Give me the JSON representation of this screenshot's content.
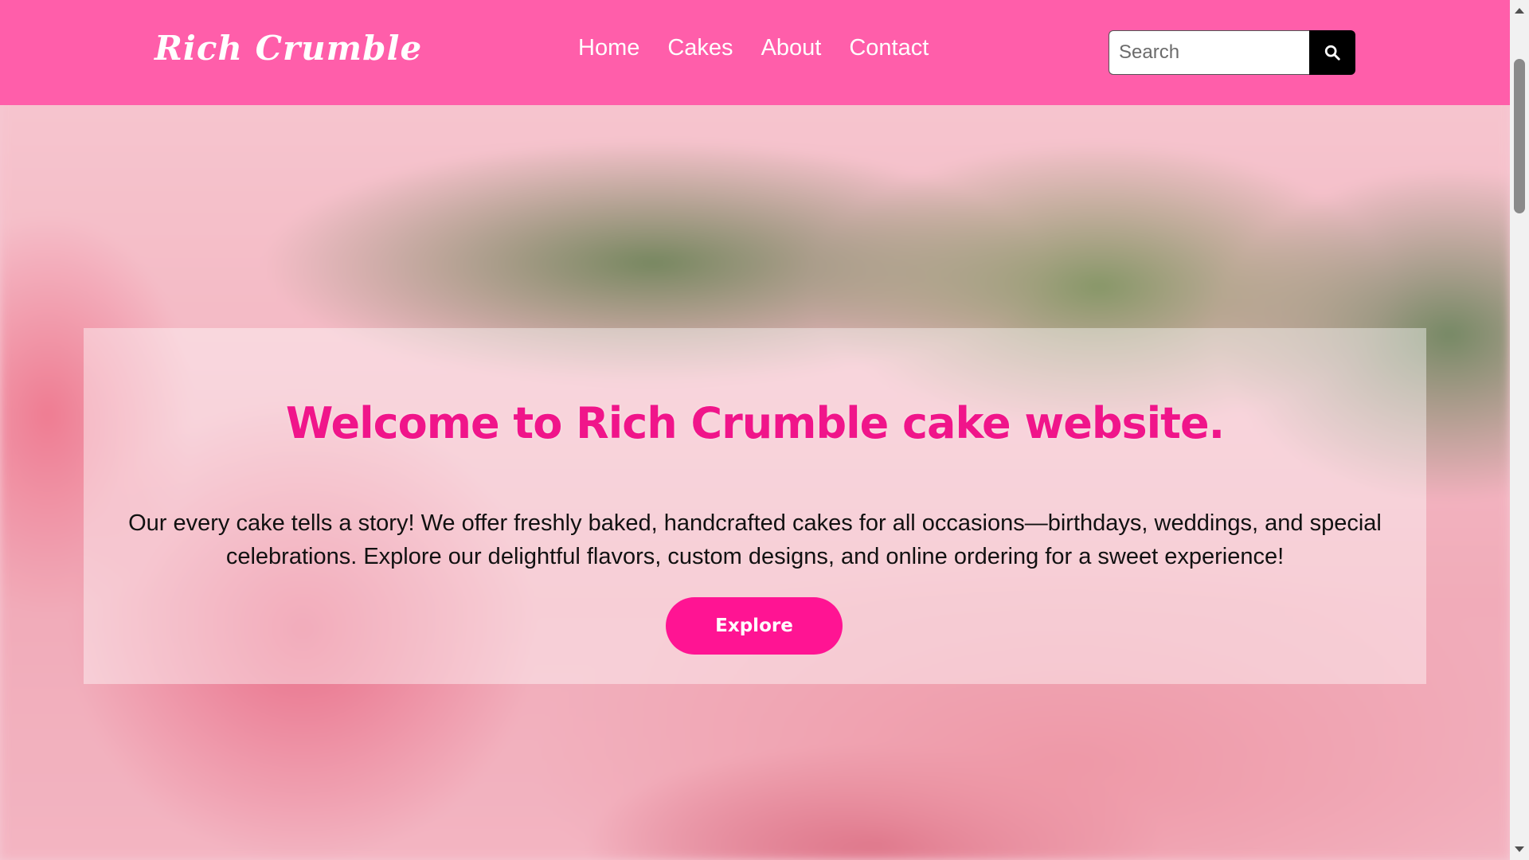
{
  "navbar": {
    "brand": "Rich Crumble",
    "links": [
      "Home",
      "Cakes",
      "About",
      "Contact"
    ],
    "search_placeholder": "Search",
    "search_icon": "magnifier-icon",
    "background_color": "#ff5eaa"
  },
  "hero": {
    "title": "Welcome to Rich Crumble cake website.",
    "description": "Our every cake tells a story! We offer freshly baked, handcrafted cakes for all occasions—birthdays, weddings, and special celebrations. Explore our delightful flavors, custom designs, and online ordering for a sweet experience!",
    "cta_label": "Explore",
    "title_color": "#f0158a",
    "cta_color": "#ff1493"
  }
}
